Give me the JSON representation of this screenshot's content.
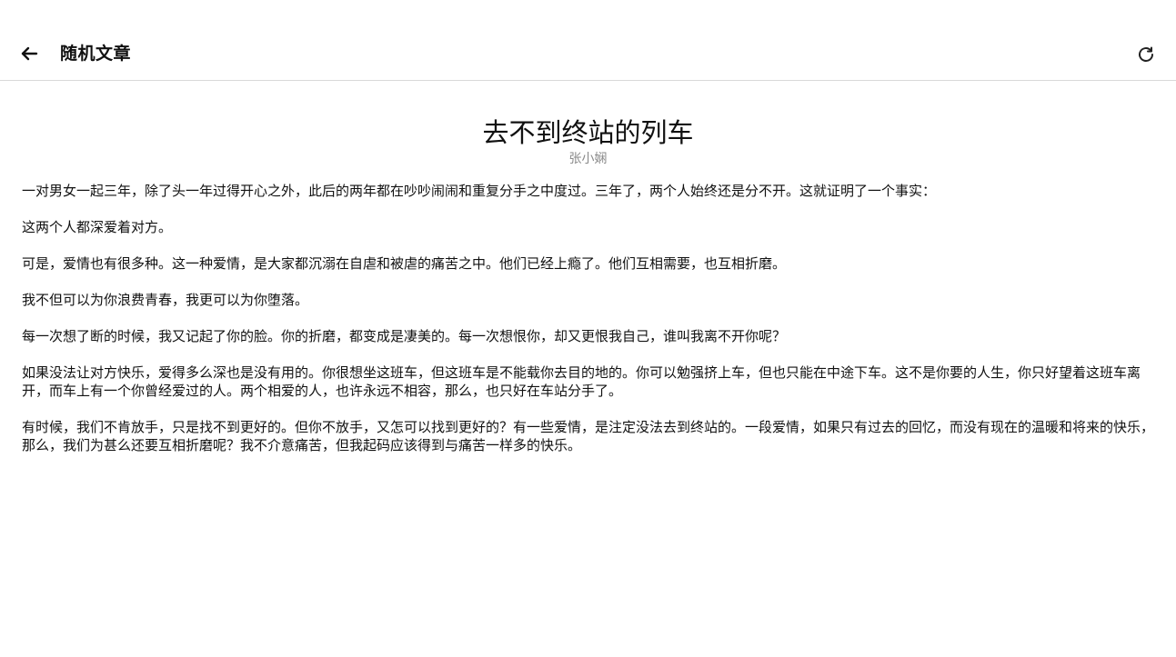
{
  "header": {
    "back_icon": "arrow-left-icon",
    "title": "随机文章",
    "refresh_icon": "refresh-icon"
  },
  "article": {
    "title": "去不到终站的列车",
    "author": "张小娴",
    "paragraphs": [
      "一对男女一起三年，除了头一年过得开心之外，此后的两年都在吵吵闹闹和重复分手之中度过。三年了，两个人始终还是分不开。这就证明了一个事实：",
      "这两个人都深爱着对方。",
      "可是，爱情也有很多种。这一种爱情，是大家都沉溺在自虐和被虐的痛苦之中。他们已经上瘾了。他们互相需要，也互相折磨。",
      "我不但可以为你浪费青春，我更可以为你堕落。",
      "每一次想了断的时候，我又记起了你的脸。你的折磨，都变成是凄美的。每一次想恨你，却又更恨我自己，谁叫我离不开你呢？",
      "如果没法让对方快乐，爱得多么深也是没有用的。你很想坐这班车，但这班车是不能载你去目的地的。你可以勉强挤上车，但也只能在中途下车。这不是你要的人生，你只好望着这班车离开，而车上有一个你曾经爱过的人。两个相爱的人，也许永远不相容，那么，也只好在车站分手了。",
      "有时候，我们不肯放手，只是找不到更好的。但你不放手，又怎可以找到更好的？有一些爱情，是注定没法去到终站的。一段爱情，如果只有过去的回忆，而没有现在的温暖和将来的快乐，那么，我们为甚么还要互相折磨呢？我不介意痛苦，但我起码应该得到与痛苦一样多的快乐。"
    ]
  }
}
